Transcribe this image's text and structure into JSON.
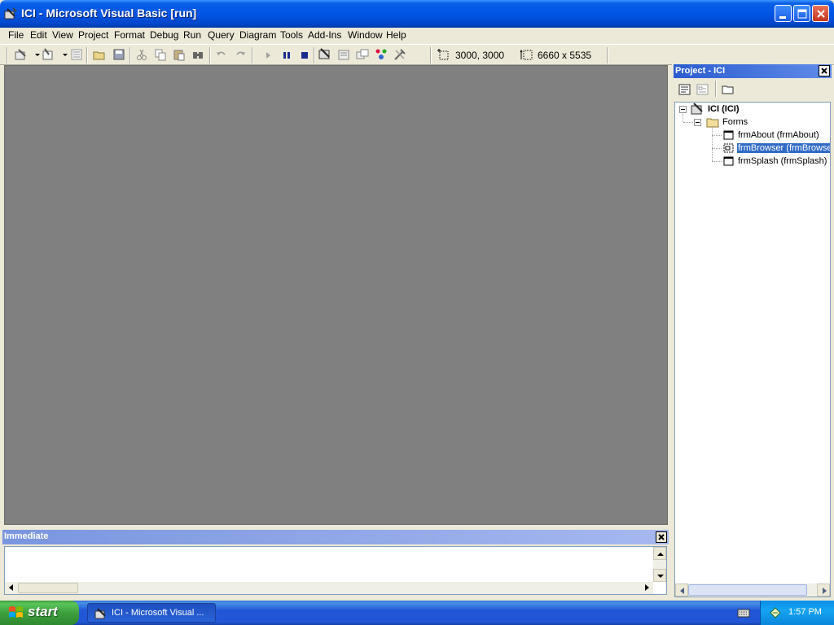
{
  "window": {
    "title": "ICI - Microsoft Visual Basic [run]"
  },
  "menu": {
    "items": [
      "File",
      "Edit",
      "View",
      "Project",
      "Format",
      "Debug",
      "Run",
      "Query",
      "Diagram",
      "Tools",
      "Add-Ins",
      "Window",
      "Help"
    ]
  },
  "toolbar": {
    "position_value": "3000, 3000",
    "size_value": "6660 x 5535"
  },
  "immediate": {
    "title": "Immediate",
    "content": ""
  },
  "project": {
    "title": "Project - ICI",
    "tree": {
      "root": "ICI (ICI)",
      "folder": "Forms",
      "forms": [
        {
          "label": "frmAbout (frmAbout)",
          "selected": false
        },
        {
          "label": "frmBrowser (frmBrowser)",
          "selected": true
        },
        {
          "label": "frmSplash (frmSplash)",
          "selected": false
        }
      ]
    }
  },
  "taskbar": {
    "start_label": "start",
    "task_label": "ICI - Microsoft Visual ...",
    "clock": "1:57 PM"
  },
  "colors": {
    "mdi_background": "#808080",
    "title_blue": "#0055e5",
    "selection": "#316ac5"
  }
}
